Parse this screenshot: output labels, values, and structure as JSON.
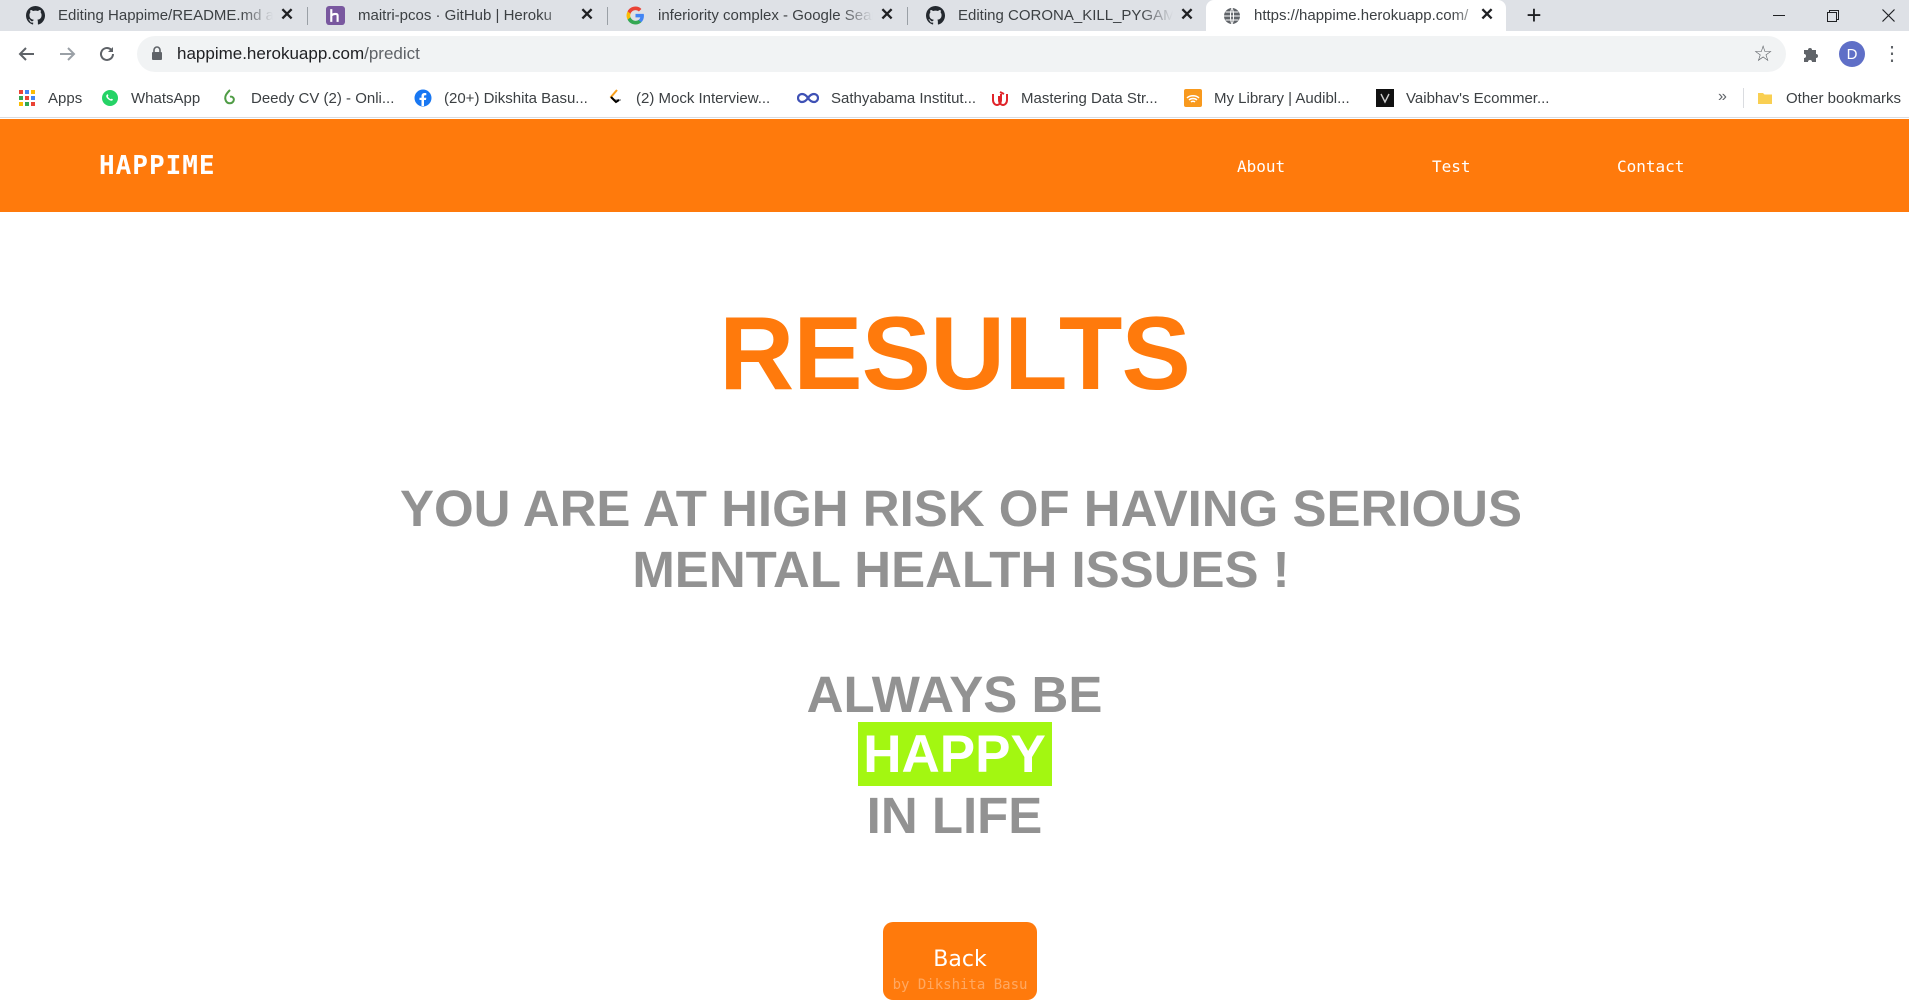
{
  "browser": {
    "tabs": [
      {
        "title": "Editing Happime/README.md at",
        "icon": "github-icon",
        "active": false
      },
      {
        "title": "maitri-pcos · GitHub | Heroku",
        "icon": "heroku-icon",
        "active": false
      },
      {
        "title": "inferiority complex - Google Sear",
        "icon": "google-icon",
        "active": false
      },
      {
        "title": "Editing CORONA_KILL_PYGAME./",
        "icon": "github-icon",
        "active": false
      },
      {
        "title": "https://happime.herokuapp.com/",
        "icon": "globe-icon",
        "active": true
      }
    ],
    "address": {
      "domain": "happime.herokuapp.com",
      "path": "/predict"
    },
    "profile_initial": "D",
    "bookmarks": [
      {
        "label": "Apps",
        "icon": "apps-grid-icon"
      },
      {
        "label": "WhatsApp",
        "icon": "whatsapp-icon"
      },
      {
        "label": "Deedy CV (2) - Onli...",
        "icon": "overleaf-icon"
      },
      {
        "label": "(20+) Dikshita Basu...",
        "icon": "facebook-icon"
      },
      {
        "label": "(2) Mock Interview...",
        "icon": "leetcode-icon"
      },
      {
        "label": "Sathyabama Institut...",
        "icon": "infinity-icon"
      },
      {
        "label": "Mastering Data Str...",
        "icon": "udemy-icon"
      },
      {
        "label": "My Library | Audibl...",
        "icon": "audible-icon"
      },
      {
        "label": "Vaibhav's Ecommer...",
        "icon": "store-icon"
      }
    ],
    "bookmarks_more": "»",
    "other_bookmarks": "Other bookmarks"
  },
  "site": {
    "brand": "HAPPIME",
    "nav": {
      "about": "About",
      "test": "Test",
      "contact": "Contact"
    },
    "heading": "RESULTS",
    "result_message": "YOU ARE AT HIGH RISK OF HAVING SERIOUS MENTAL HEALTH ISSUES !",
    "tagline": {
      "line1": "ALWAYS BE",
      "highlight": "HAPPY",
      "line3": "IN LIFE"
    },
    "back_button": "Back",
    "credit": "by Dikshita Basu"
  },
  "colors": {
    "accent": "#ff7a0c",
    "highlight": "#a3f711",
    "text_gray": "#929292"
  }
}
